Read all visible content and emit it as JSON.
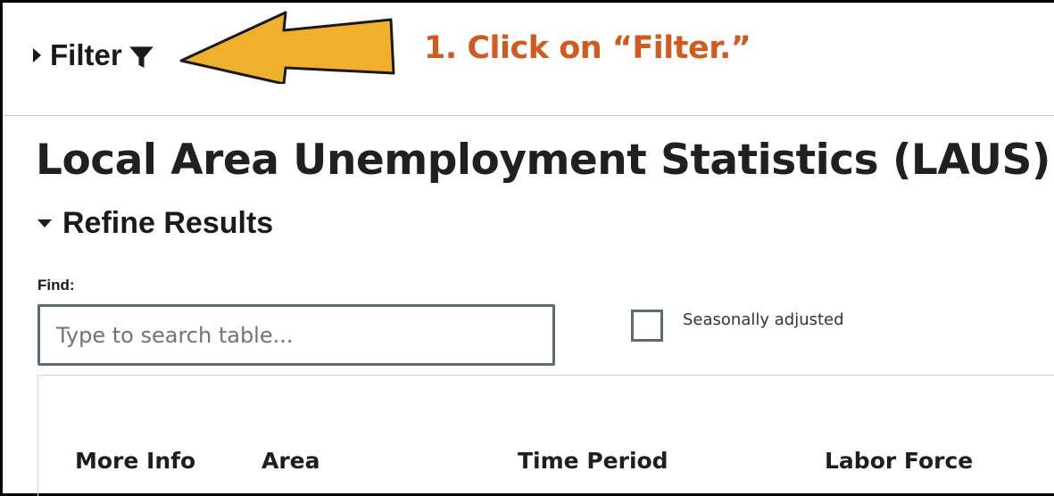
{
  "filter": {
    "label": "Filter"
  },
  "annotation": {
    "text": "1. Click on “Filter.”",
    "color": "#d05a1f",
    "arrow_color": "#f0b02e"
  },
  "page_title": "Local Area Unemployment Statistics (LAUS)",
  "refine": {
    "label": "Refine Results"
  },
  "find": {
    "label": "Find:",
    "placeholder": "Type to search table...",
    "value": ""
  },
  "seasonal": {
    "label": "Seasonally adjusted",
    "checked": false
  },
  "table": {
    "columns": [
      "More Info",
      "Area",
      "Time Period",
      "Labor Force"
    ]
  },
  "icons": {
    "filter": "funnel-icon",
    "collapsed": "caret-right-icon",
    "expanded": "caret-down-icon"
  }
}
